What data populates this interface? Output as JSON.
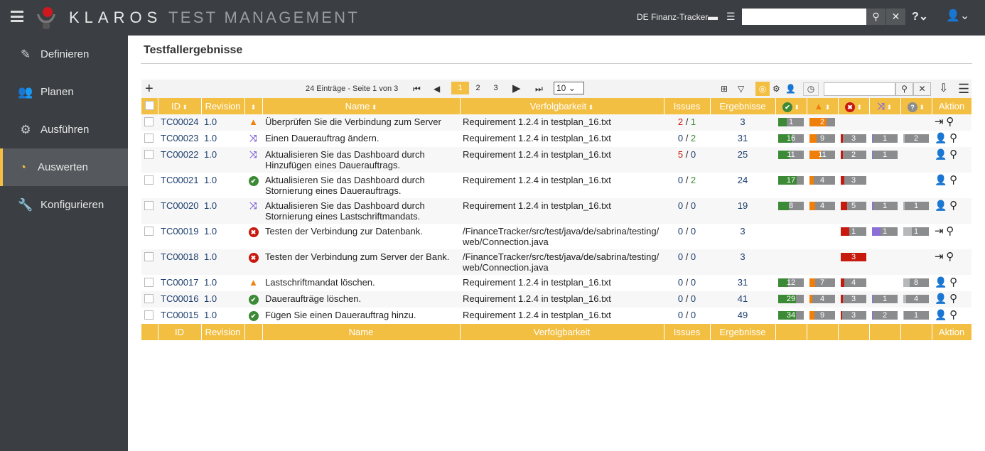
{
  "header": {
    "brand": "KLAROS",
    "brand_sub": "TEST MANAGEMENT",
    "project": "DE Finanz-Tracker",
    "search_value": ""
  },
  "sidebar": {
    "items": [
      {
        "label": "Definieren",
        "icon": "edit-icon"
      },
      {
        "label": "Planen",
        "icon": "users-icon"
      },
      {
        "label": "Ausführen",
        "icon": "gear-icon"
      },
      {
        "label": "Auswerten",
        "icon": "pie-chart-icon",
        "active": true
      },
      {
        "label": "Konfigurieren",
        "icon": "wrench-icon"
      }
    ]
  },
  "page_title": "Testfallergebnisse",
  "pager": {
    "info": "24 Einträge - Seite 1 von 3",
    "pages": [
      "1",
      "2",
      "3"
    ],
    "current": "1",
    "page_size": "10"
  },
  "columns": {
    "id": "ID",
    "revision": "Revision",
    "name": "Name",
    "trace": "Verfolgbarkeit",
    "issues": "Issues",
    "results": "Ergebnisse",
    "action": "Aktion"
  },
  "colors": {
    "pass": "#3c8a35",
    "warn": "#f07f0a",
    "fail": "#c8190f",
    "skip": "#8b6fd6",
    "unknown": "#b6b8ba",
    "accent": "#f3bf42"
  },
  "rows": [
    {
      "id": "TC00024",
      "rev": "1.0",
      "status": "warn",
      "name": "Überprüfen Sie die Verbindung zum Server",
      "trace": "Requirement 1.2.4 in testplan_16.txt",
      "iss_a": "2",
      "iss_b": "1",
      "results": "3",
      "counts": [
        1,
        2,
        0,
        0,
        0
      ],
      "action": "import"
    },
    {
      "id": "TC00023",
      "rev": "1.0",
      "status": "skip",
      "name": "Einen Dauerauftrag ändern.",
      "trace": "Requirement 1.2.4 in testplan_16.txt",
      "iss_a": "0",
      "iss_b": "2",
      "results": "31",
      "counts": [
        16,
        9,
        3,
        1,
        2
      ],
      "action": "assign"
    },
    {
      "id": "TC00022",
      "rev": "1.0",
      "status": "skip",
      "name": "Aktualisieren Sie das Dashboard durch Hinzufügen eines Dauerauftrags.",
      "trace": "Requirement 1.2.4 in testplan_16.txt",
      "iss_a": "5",
      "iss_b": "0",
      "results": "25",
      "counts": [
        11,
        11,
        2,
        1,
        0
      ],
      "action": "assign"
    },
    {
      "id": "TC00021",
      "rev": "1.0",
      "status": "pass",
      "name": "Aktualisieren Sie das Dashboard durch Stornierung eines Dauerauftrags.",
      "trace": "Requirement 1.2.4 in testplan_16.txt",
      "iss_a": "0",
      "iss_b": "2",
      "results": "24",
      "counts": [
        17,
        4,
        3,
        0,
        0
      ],
      "action": "assign"
    },
    {
      "id": "TC00020",
      "rev": "1.0",
      "status": "skip",
      "name": "Aktualisieren Sie das Dashboard durch Stornierung eines Lastschriftmandats.",
      "trace": "Requirement 1.2.4 in testplan_16.txt",
      "iss_a": "0",
      "iss_b": "0",
      "results": "19",
      "counts": [
        8,
        4,
        5,
        1,
        1
      ],
      "action": "assign"
    },
    {
      "id": "TC00019",
      "rev": "1.0",
      "status": "fail",
      "name": "Testen der Verbindung zur Datenbank.",
      "trace": "/FinanceTracker/src/test/java/de/sabrina/testing/web/Connection.java",
      "iss_a": "0",
      "iss_b": "0",
      "results": "3",
      "counts": [
        0,
        0,
        1,
        1,
        1
      ],
      "action": "import"
    },
    {
      "id": "TC00018",
      "rev": "1.0",
      "status": "fail",
      "name": "Testen der Verbindung zum Server der Bank.",
      "trace": "/FinanceTracker/src/test/java/de/sabrina/testing/web/Connection.java",
      "iss_a": "0",
      "iss_b": "0",
      "results": "3",
      "counts": [
        0,
        0,
        3,
        0,
        0
      ],
      "action": "import"
    },
    {
      "id": "TC00017",
      "rev": "1.0",
      "status": "warn",
      "name": "Lastschriftmandat löschen.",
      "trace": "Requirement 1.2.4 in testplan_16.txt",
      "iss_a": "0",
      "iss_b": "0",
      "results": "31",
      "counts": [
        12,
        7,
        4,
        0,
        8
      ],
      "action": "assign"
    },
    {
      "id": "TC00016",
      "rev": "1.0",
      "status": "pass",
      "name": "Daueraufträge löschen.",
      "trace": "Requirement 1.2.4 in testplan_16.txt",
      "iss_a": "0",
      "iss_b": "0",
      "results": "41",
      "counts": [
        29,
        4,
        3,
        1,
        4
      ],
      "action": "assign"
    },
    {
      "id": "TC00015",
      "rev": "1.0",
      "status": "pass",
      "name": "Fügen Sie einen Dauerauftrag hinzu.",
      "trace": "Requirement 1.2.4 in testplan_16.txt",
      "iss_a": "0",
      "iss_b": "0",
      "results": "49",
      "counts": [
        34,
        9,
        3,
        2,
        1
      ],
      "action": "assign"
    }
  ]
}
